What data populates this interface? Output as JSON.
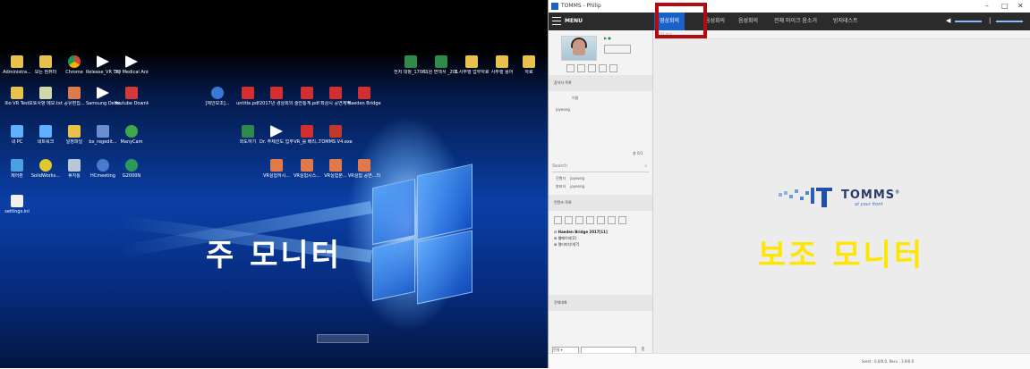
{
  "desktop": {
    "caption": "주 모니터",
    "search_text": "",
    "icons_row1": [
      "Administra...",
      "모든 컴퓨터",
      "Chrome",
      "Release_VR Thya Imme...",
      "3D Medical Animation..."
    ],
    "icons_row2": [
      "Ilio VR Test",
      "모토사항 메모.txt",
      "공유편집...",
      "Samsung Demo - Sp...",
      "Youtube Download..."
    ],
    "icons_row3": [
      "내 PC",
      "네트워크",
      "일정파일",
      "bx_regedit...",
      "ManyCam"
    ],
    "icons_row4": [
      "제어판",
      "SolidWorks...",
      "휴지통",
      "HCmeeting",
      "G2000N"
    ],
    "icons_row5": [
      "settings.ini"
    ],
    "icons_right_top": [
      "전처 대항_1706...",
      "의원 면책서 _20170425...",
      "1.사무행 업무자료",
      "사무행 용어",
      "자료"
    ],
    "icons_mid1": [
      "[제안보조]...",
      "untitle.pdf",
      "2017년 경상회의...",
      "술안통계.pdf",
      "최상시 공연계약",
      "Haeden Bridge"
    ],
    "icons_mid2": [
      "와도하기",
      "Dr. 주제선도 업무표현...",
      "VR_를 배리...",
      "TOMMS V4.exe"
    ],
    "icons_mid3": [
      "VR실험하시...",
      "VR실험시스...",
      "VR실험분...",
      "VR실험 공연...리"
    ]
  },
  "app": {
    "title": "TOMMS - Philip",
    "menu_label": "MENU",
    "tabs": [
      "영상회의",
      "음성회의",
      "음성회의",
      "전체 마이크 음소거",
      "방지테스트"
    ],
    "active_tab": "영상회의",
    "winctl": [
      "–",
      "□",
      "✕"
    ],
    "participants_header": "참석자 목록",
    "participants_col": "이름",
    "participants": [
      "joyeong"
    ],
    "participants_count": "총 0/1",
    "search_placeholder": "Search",
    "roles": [
      {
        "role": "진행자",
        "name": "joyeong"
      },
      {
        "role": "발표자",
        "name": "joyeong"
      }
    ],
    "contents_header": "컨텐츠 목록",
    "tree": [
      "Haeden Bridge 2017[11]",
      "웹페이지[2]",
      "멀티미디어[?]"
    ],
    "chat_header": "전체대화",
    "chat_select": "전체",
    "main_strip": "1/1 보기",
    "logo_name": "TOMMS",
    "logo_reg": "®",
    "logo_tagline": "at your front",
    "sub_caption": "보조 모니터",
    "status": "Send : 0.0/0.0,  Recv : 3.9/0.0"
  }
}
